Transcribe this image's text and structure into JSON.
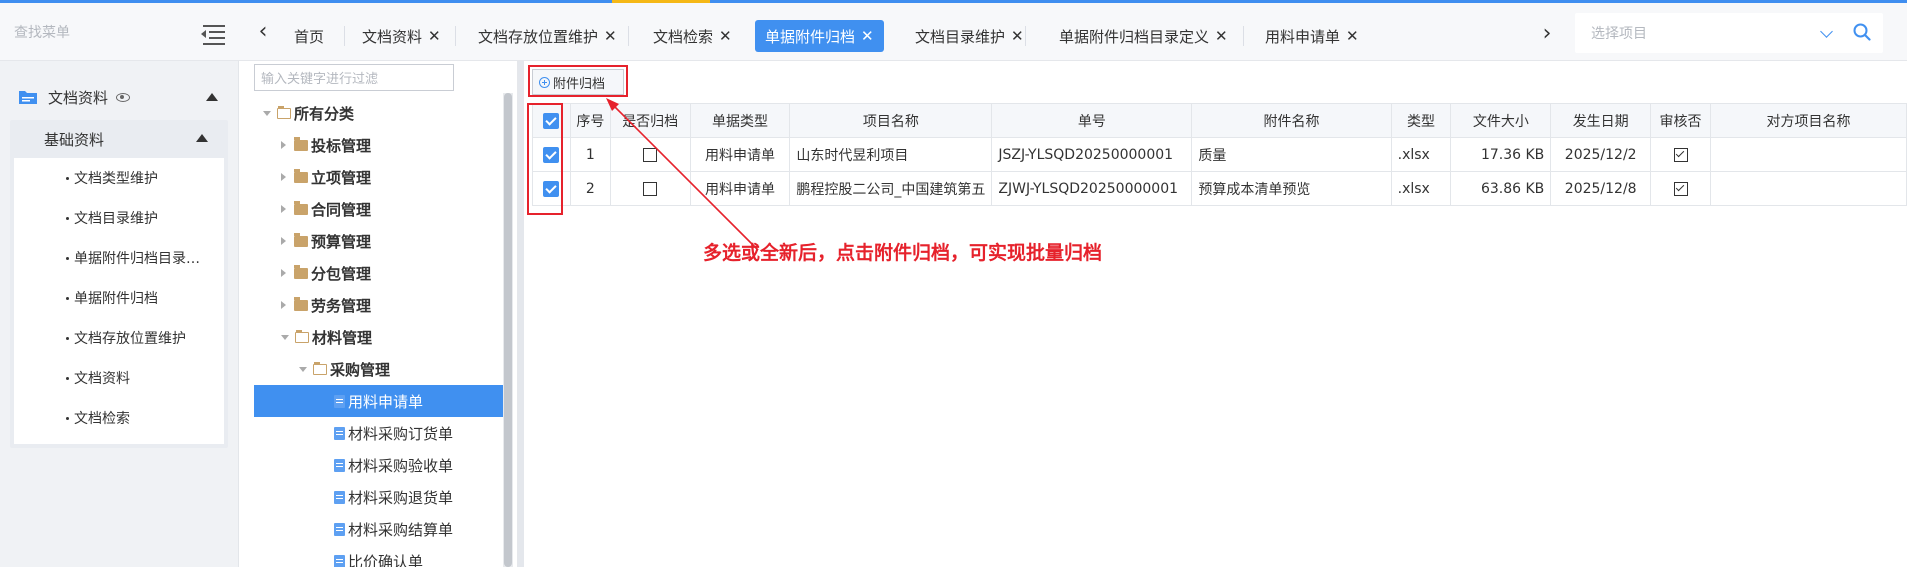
{
  "sidebar": {
    "search_placeholder": "查找菜单",
    "group_label": "文档资料",
    "sub_title": "基础资料",
    "items": [
      {
        "label": "文档类型维护"
      },
      {
        "label": "文档目录维护"
      },
      {
        "label": "单据附件归档目录…"
      },
      {
        "label": "单据附件归档"
      },
      {
        "label": "文档存放位置维护"
      },
      {
        "label": "文档资料"
      },
      {
        "label": "文档检索"
      }
    ]
  },
  "tabs": {
    "items": [
      {
        "label": "首页"
      },
      {
        "label": "文档资料"
      },
      {
        "label": "文档存放位置维护"
      },
      {
        "label": "文档检索"
      },
      {
        "label": "单据附件归档"
      },
      {
        "label": "文档目录维护"
      },
      {
        "label": "单据附件归档目录定义"
      },
      {
        "label": "用料申请单"
      }
    ],
    "close_glyph": "✕",
    "project_placeholder": "选择项目"
  },
  "tree": {
    "filter_placeholder": "输入关键字进行过滤",
    "nodes": [
      {
        "label": "所有分类"
      },
      {
        "label": "投标管理"
      },
      {
        "label": "立项管理"
      },
      {
        "label": "合同管理"
      },
      {
        "label": "预算管理"
      },
      {
        "label": "分包管理"
      },
      {
        "label": "劳务管理"
      },
      {
        "label": "材料管理"
      },
      {
        "label": "采购管理"
      },
      {
        "label": "用料申请单"
      },
      {
        "label": "材料采购订货单"
      },
      {
        "label": "材料采购验收单"
      },
      {
        "label": "材料采购退货单"
      },
      {
        "label": "材料采购结算单"
      },
      {
        "label": "比价确认单"
      }
    ]
  },
  "toolbar": {
    "archive_label": "附件归档"
  },
  "table": {
    "headers": [
      "序号",
      "是否归档",
      "单据类型",
      "项目名称",
      "单号",
      "附件名称",
      "类型",
      "文件大小",
      "发生日期",
      "审核否",
      "对方项目名称"
    ],
    "rows": [
      {
        "no": "1",
        "doc_type": "用料申请单",
        "project": "山东时代昱利项目",
        "code": "JSZJ-YLSQD20250000001",
        "attachment": "质量",
        "ext": ".xlsx",
        "size": "17.36 KB",
        "date": "2025/12/2"
      },
      {
        "no": "2",
        "doc_type": "用料申请单",
        "project": "鹏程控股二公司_中国建筑第五",
        "code": "ZJWJ-YLSQD20250000001",
        "attachment": "预算成本清单预览",
        "ext": ".xlsx",
        "size": "63.86 KB",
        "date": "2025/12/8"
      }
    ]
  },
  "annotation": {
    "text": "多选或全新后，点击附件归档，可实现批量归档"
  },
  "colors": {
    "accent": "#4090f0",
    "annotation": "#e6222c",
    "link": "#4a8ee6"
  }
}
